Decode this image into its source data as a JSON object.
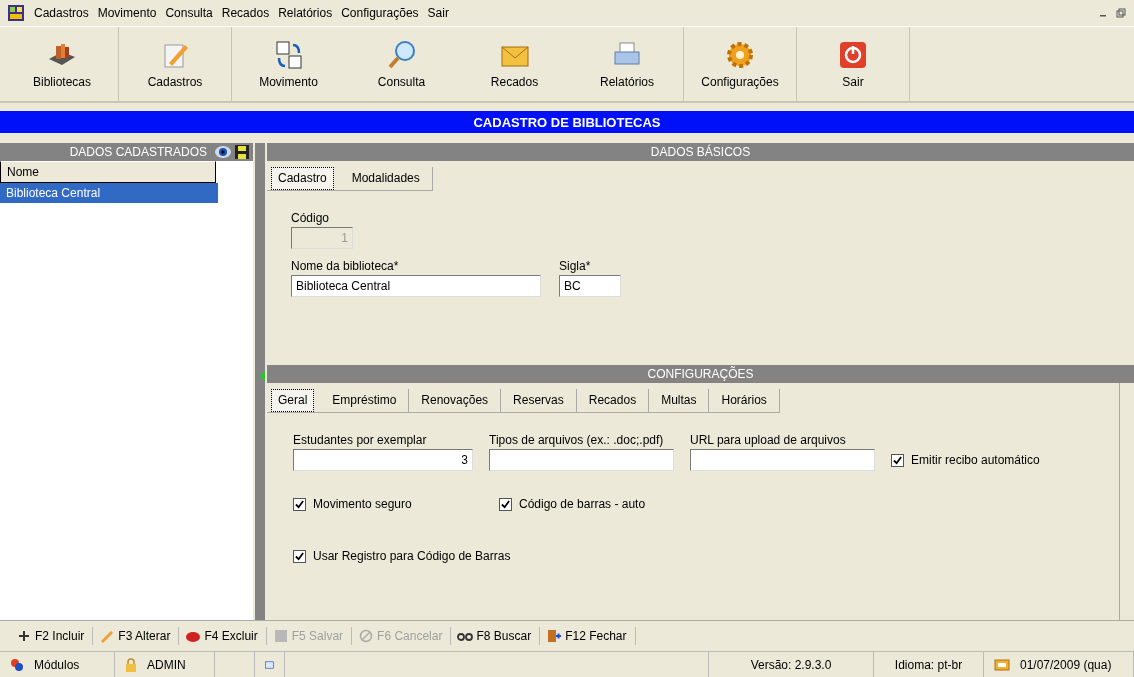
{
  "menu": [
    "Cadastros",
    "Movimento",
    "Consulta",
    "Recados",
    "Relatórios",
    "Configurações",
    "Sair"
  ],
  "toolbar": [
    {
      "label": "Bibliotecas"
    },
    {
      "label": "Cadastros"
    },
    {
      "label": "Movimento"
    },
    {
      "label": "Consulta"
    },
    {
      "label": "Recados"
    },
    {
      "label": "Relatórios"
    },
    {
      "label": "Configurações"
    },
    {
      "label": "Sair"
    }
  ],
  "title": "CADASTRO DE BIBLIOTECAS",
  "list": {
    "header": "DADOS CADASTRADOS",
    "column": "Nome",
    "rows": [
      {
        "text": "Biblioteca Central",
        "selected": true
      }
    ]
  },
  "basic": {
    "header": "DADOS BÁSICOS",
    "tabs": [
      {
        "label": "Cadastro",
        "selected": true
      },
      {
        "label": "Modalidades",
        "selected": false
      }
    ],
    "codigo": {
      "label": "Código",
      "value": "1",
      "disabled": true
    },
    "nome": {
      "label": "Nome da biblioteca*",
      "value": "Biblioteca Central"
    },
    "sigla": {
      "label": "Sigla*",
      "value": "BC"
    }
  },
  "config": {
    "header": "CONFIGURAÇÕES",
    "tabs": [
      {
        "label": "Geral",
        "selected": true
      },
      {
        "label": "Empréstimo",
        "selected": false
      },
      {
        "label": "Renovações",
        "selected": false
      },
      {
        "label": "Reservas",
        "selected": false
      },
      {
        "label": "Recados",
        "selected": false
      },
      {
        "label": "Multas",
        "selected": false
      },
      {
        "label": "Horários",
        "selected": false
      }
    ],
    "fields": [
      {
        "label": "Estudantes por exemplar",
        "value": "3"
      },
      {
        "label": "Tipos de arquivos (ex.: .doc;.pdf)"
      },
      {
        "label": "URL para upload de arquivos"
      }
    ],
    "recibo": {
      "label": "Emitir recibo automático",
      "checked": true
    },
    "checks": [
      {
        "label": "Movimento seguro",
        "checked": true
      },
      {
        "label": "Código de barras - auto",
        "checked": true
      }
    ],
    "registro": {
      "label": "Usar Registro para Código de Barras",
      "checked": true
    }
  },
  "actions": [
    {
      "label": "F2 Incluir",
      "disabled": false
    },
    {
      "label": "F3 Alterar",
      "disabled": false
    },
    {
      "label": "F4 Excluir",
      "disabled": false
    },
    {
      "label": "F5 Salvar",
      "disabled": true
    },
    {
      "label": "F6 Cancelar",
      "disabled": true
    },
    {
      "label": "F8 Buscar",
      "disabled": false
    },
    {
      "label": "F12 Fechar",
      "disabled": false
    }
  ],
  "status": {
    "modules": "Módulos",
    "user": "ADMIN",
    "version": "Versão: 2.9.3.0",
    "language": "Idioma: pt-br",
    "date": "01/07/2009 (qua)"
  }
}
